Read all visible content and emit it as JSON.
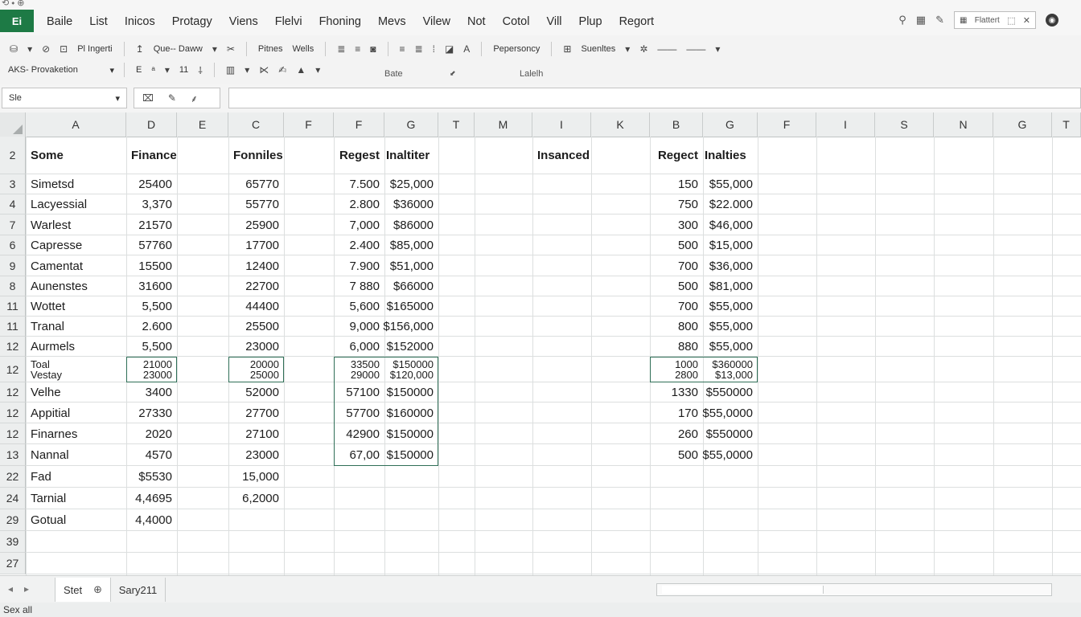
{
  "app": {
    "logo": "Ei",
    "menu": [
      "Baile",
      "List",
      "Inicos",
      "Protagy",
      "Viens",
      "Flelvi",
      "Fhoning",
      "Mevs",
      "Vilew",
      "Not",
      "Cotol",
      "Vill",
      "Plup",
      "Regort"
    ],
    "account_label": "Flattert"
  },
  "ribbon": {
    "row1": {
      "item_report": "Pl Ingerti",
      "item_query": "Que-- Daww",
      "item_pmes": "Pitnes",
      "item_wells": "Wells",
      "item_prop": "Pepersoncy",
      "item_survives": "Suenltes"
    },
    "row2": {
      "font_name": "AKS- Provaketion",
      "font_b": "E",
      "font_size": "11"
    },
    "group_labels": [
      "Bate",
      "Lalelh"
    ]
  },
  "formula_bar": {
    "name_box": "Sle",
    "formula": ""
  },
  "columns": [
    "A",
    "D",
    "E",
    "C",
    "F",
    "F",
    "G",
    "T",
    "M",
    "I",
    "K",
    "B",
    "G",
    "F",
    "I",
    "S",
    "N",
    "G",
    "T"
  ],
  "rows": [
    {
      "num": "2",
      "cells": {
        "name": "Some",
        "col1": "Finance",
        "col3": "Fonniles",
        "col5": "Regest",
        "col6": "Inaltiter",
        "col9": "Insanced",
        "col11": "Regect",
        "col12": "Inalties"
      }
    },
    {
      "num": "3",
      "cells": {
        "name": "Simetsd",
        "col1": "25400",
        "col3": "65770",
        "col5": "7.500",
        "col6": "$25,000",
        "col11": "150",
        "col12": "$55,000"
      }
    },
    {
      "num": "4",
      "cells": {
        "name": "Lacyessial",
        "col1": "3,370",
        "col3": "55770",
        "col5": "2.800",
        "col6": "$36000",
        "col11": "750",
        "col12": "$22.000"
      }
    },
    {
      "num": "7",
      "cells": {
        "name": "Warlest",
        "col1": "21570",
        "col3": "25900",
        "col5": "7,000",
        "col6": "$86000",
        "col11": "300",
        "col12": "$46,000"
      }
    },
    {
      "num": "6",
      "cells": {
        "name": "Capresse",
        "col1": "57760",
        "col3": "17700",
        "col5": "2.400",
        "col6": "$85,000",
        "col11": "500",
        "col12": "$15,000"
      }
    },
    {
      "num": "9",
      "cells": {
        "name": "Camentat",
        "col1": "15500",
        "col3": "12400",
        "col5": "7.900",
        "col6": "$51,000",
        "col11": "700",
        "col12": "$36,000"
      }
    },
    {
      "num": "8",
      "cells": {
        "name": "Aunenstes",
        "col1": "31600",
        "col3": "22700",
        "col5": "7 880",
        "col6": "$66000",
        "col11": "500",
        "col12": "$81,000"
      }
    },
    {
      "num": "11",
      "cells": {
        "name": "Wottet",
        "col1": "5,500",
        "col3": "44400",
        "col5": "5,600",
        "col6": "$165000",
        "col11": "700",
        "col12": "$55,000"
      }
    },
    {
      "num": "11",
      "cells": {
        "name": "Tranal",
        "col1": "2.600",
        "col3": "25500",
        "col5": "9,000",
        "col6": "$156,000",
        "col11": "800",
        "col12": "$55,000"
      }
    },
    {
      "num": "12",
      "cells": {
        "name": "Aurmels",
        "col1": "5,500",
        "col3": "23000",
        "col5": "6,000",
        "col6": "$152000",
        "col11": "880",
        "col12": "$55,000"
      }
    },
    {
      "num": "12",
      "stacked": true,
      "cells": {
        "name": "Toal",
        "name2": "Vestay",
        "col1": "21000",
        "col1b": "23000",
        "col3": "20000",
        "col3b": "25000",
        "col5": "33500",
        "col5b": "29000",
        "col6": "$150000",
        "col6b": "$120,000",
        "col11": "1000",
        "col11b": "2800",
        "col12": "$360000",
        "col12b": "$13,000"
      }
    },
    {
      "num": "12",
      "cells": {
        "name": "Velhe",
        "col1": "3400",
        "col3": "52000",
        "col5": "57100",
        "col6": "$150000",
        "col11": "1330",
        "col12": "$550000"
      }
    },
    {
      "num": "12",
      "cells": {
        "name": "Appitial",
        "col1": "27330",
        "col3": "27700",
        "col5": "57700",
        "col6": "$160000",
        "col11": "170",
        "col12": "$55,0000"
      }
    },
    {
      "num": "12",
      "cells": {
        "name": "Finarnes",
        "col1": "2020",
        "col3": "27100",
        "col5": "42900",
        "col6": "$150000",
        "col11": "260",
        "col12": "$550000"
      }
    },
    {
      "num": "13",
      "cells": {
        "name": "Nannal",
        "col1": "4570",
        "col3": "23000",
        "col5": "67,00",
        "col6": "$150000",
        "col11": "500",
        "col12": "$55,0000"
      }
    },
    {
      "num": "22",
      "cells": {
        "name": "Fad",
        "col1": "$5530",
        "col3": "15,000"
      }
    },
    {
      "num": "24",
      "cells": {
        "name": "Tarnial",
        "col1": "4,4695",
        "col3": "6,2000"
      }
    },
    {
      "num": "29",
      "cells": {
        "name": "Gotual",
        "col1": "4,4000"
      }
    },
    {
      "num": "39",
      "cells": {}
    },
    {
      "num": "27",
      "cells": {}
    }
  ],
  "sheets": {
    "tab1": "Stet",
    "tab2": "Sary211"
  },
  "status": {
    "text": "Sex all"
  }
}
